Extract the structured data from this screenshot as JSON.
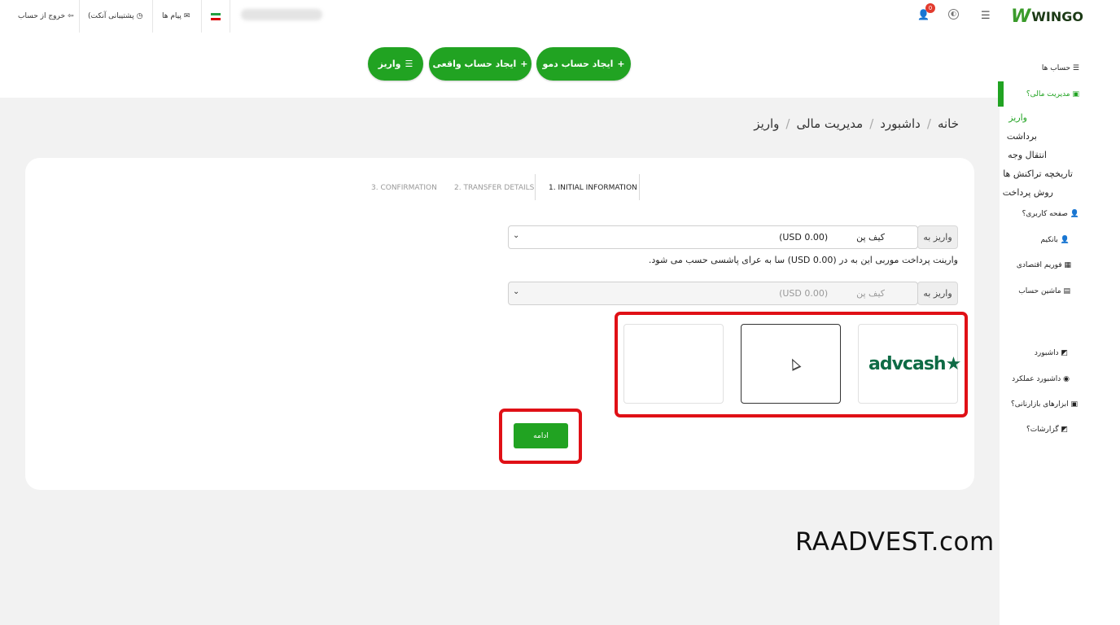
{
  "topbar": {
    "logout": "خروج از حساب",
    "support": "پشتیبانی آنکت)",
    "messages": "پیام ها",
    "logo": "WINGO",
    "notifications_count": "0"
  },
  "actions": {
    "demo_account": "ایجاد حساب دمو",
    "real_account": "ایجاد حساب واقعی",
    "deposit": "واریز"
  },
  "sidebar": {
    "accounts": "حساب ها",
    "finance": "مدیریت مالی؟",
    "finance_items": [
      "واریز",
      "برداشت",
      "انتقال وجه",
      "تاریخچه تراکنش ها",
      "روش پرداخت"
    ],
    "profile": "صفحه کاربری؟",
    "bonus": "بانکیم",
    "forum": "فوریم اقتصادی",
    "calculator": "ماشین حساب",
    "dashboard": "داشبورد",
    "performance": "داشبورد عملکرد",
    "trading_tools": "ابزارهای بازارنانی؟",
    "reports": "گزارشات؟"
  },
  "breadcrumb": [
    "خانه",
    "داشبورد",
    "مدیریت مالی",
    "واریز"
  ],
  "steps": [
    "1. INITIAL INFORMATION",
    "2. TRANSFER DETAILS",
    "3. CONFIRMATION"
  ],
  "form": {
    "deposit_to_label": "واریز به",
    "wallet_value": "کیف پن",
    "wallet_amount": "(USD 0.00)",
    "note": "وارینت پرداخت موربی این به در (USD 0.00) سا به عرای پاشسی حسب می شود.",
    "deposit_to_label_2": "واریز به",
    "wallet_value_2": "کیف پن",
    "wallet_amount_2": "(USD 0.00)",
    "payment_methods": [
      "advcash",
      "",
      ""
    ],
    "continue": "ادامه"
  },
  "colors": {
    "accent": "#21a322",
    "highlight": "#e01016"
  },
  "watermark": "RAADVEST.com"
}
